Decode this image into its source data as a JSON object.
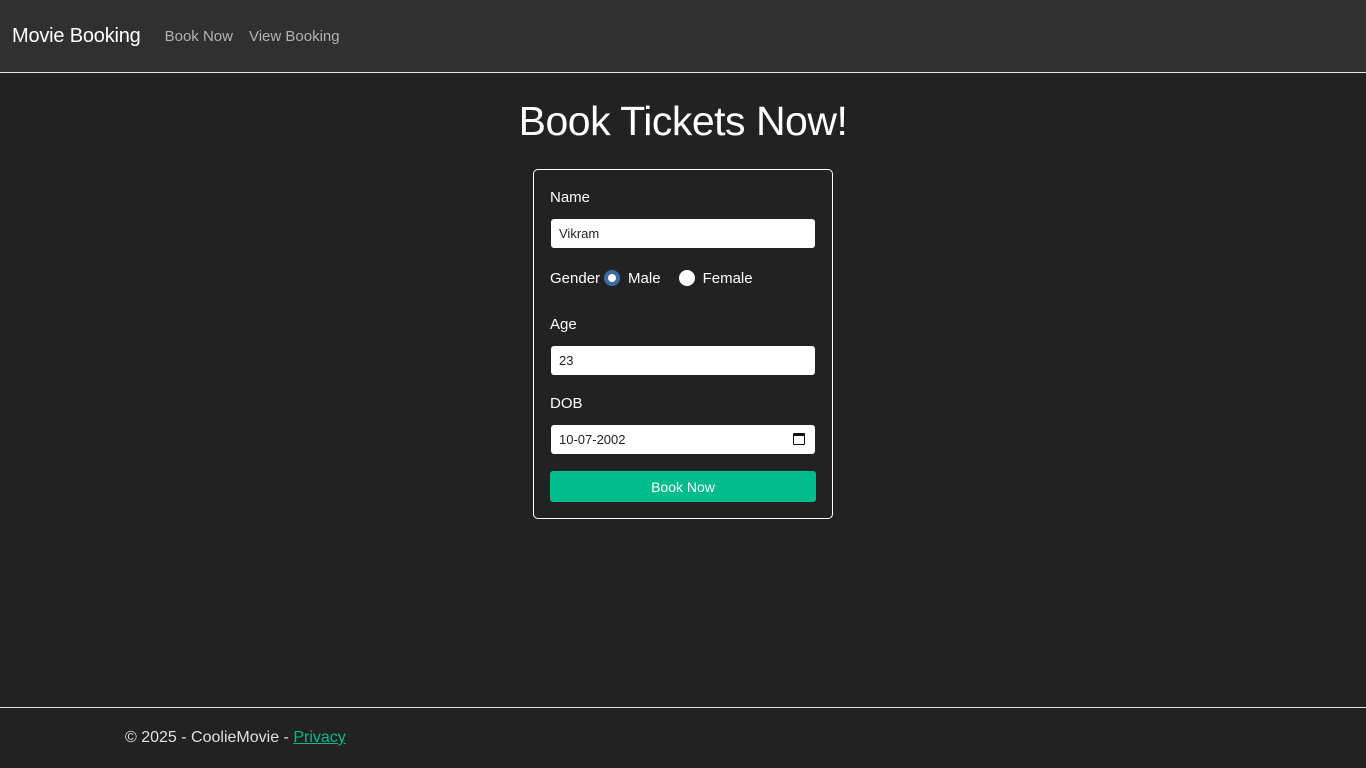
{
  "navbar": {
    "brand": "Movie Booking",
    "links": [
      {
        "label": "Book Now"
      },
      {
        "label": "View Booking"
      }
    ]
  },
  "page": {
    "title": "Book Tickets Now!"
  },
  "form": {
    "name": {
      "label": "Name",
      "value": "Vikram"
    },
    "gender": {
      "label": "Gender",
      "options": [
        {
          "label": "Male",
          "checked": true
        },
        {
          "label": "Female",
          "checked": false
        }
      ]
    },
    "age": {
      "label": "Age",
      "value": "23"
    },
    "dob": {
      "label": "DOB",
      "value": "10-07-2002"
    },
    "submit_label": "Book Now"
  },
  "footer": {
    "copyright": "© 2025 - CoolieMovie - ",
    "privacy_link": "Privacy"
  },
  "colors": {
    "accent": "#00bc8c",
    "background": "#222222",
    "navbar": "#303030",
    "radio_checked": "#3e6aa6"
  }
}
